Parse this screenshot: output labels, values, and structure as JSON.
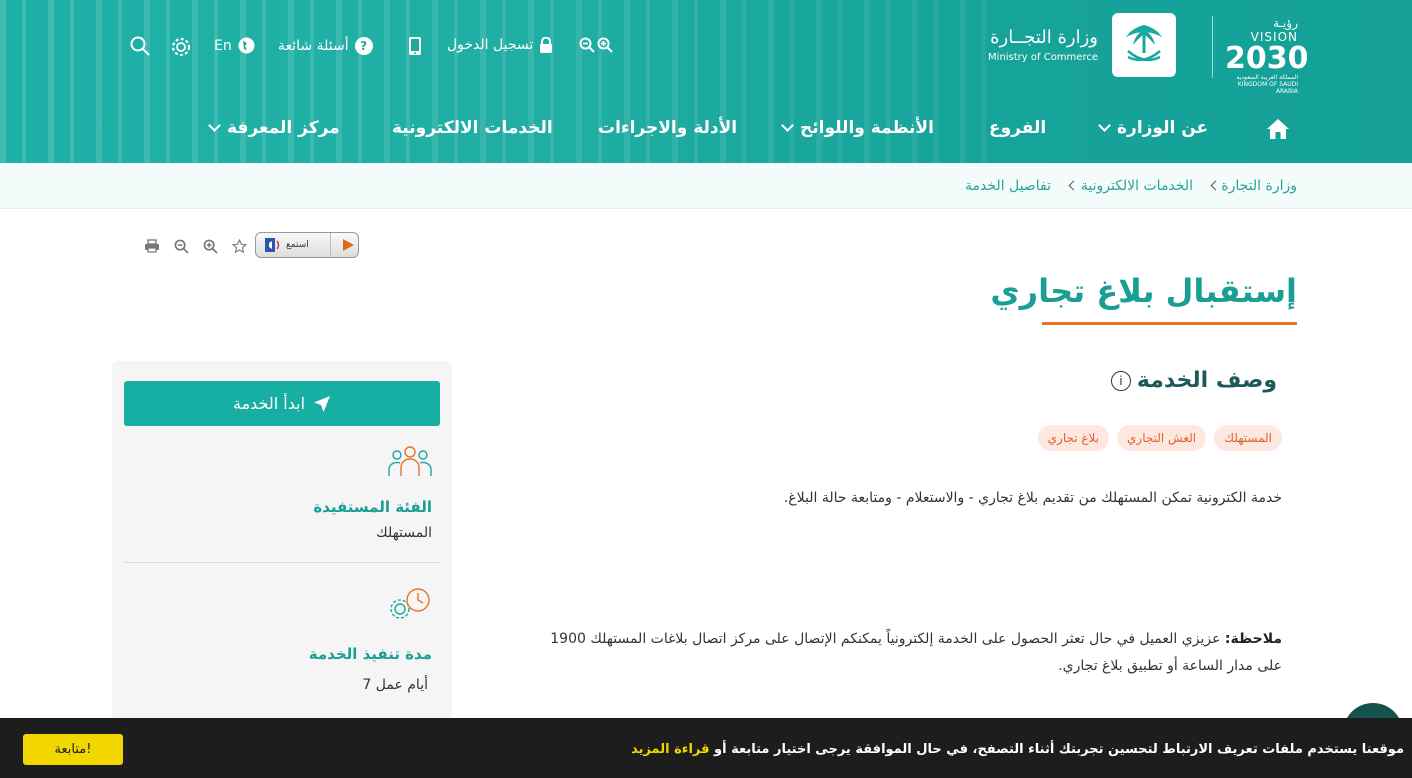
{
  "header": {
    "vision_top": "رؤيـة VISION",
    "vision_year": "2030",
    "vision_sub": "المملكة العربية السعودية KINGDOM OF SAUDI ARABIA",
    "ministry_ar": "وزارة التجــارة",
    "ministry_en": "Ministry of Commerce",
    "topbar": {
      "login": "تسجيل الدخول",
      "faq": "أسئلة شائعة",
      "lang": "En"
    },
    "nav": [
      {
        "label": "عن الوزارة"
      },
      {
        "label": "الفروع"
      },
      {
        "label": "الأنظمة واللوائح"
      },
      {
        "label": "الأدلة والاجراءات"
      },
      {
        "label": "الخدمات الالكترونية"
      },
      {
        "label": "مركز المعرفة"
      }
    ]
  },
  "breadcrumb": [
    "وزارة التجارة",
    "الخدمات الالكترونية",
    "تفاصيل الخدمة"
  ],
  "listen_label": "استمع",
  "page_title": "إستقبال بلاغ تجاري",
  "section_title": "وصف الخدمة",
  "tags": [
    "المستهلك",
    "الغش التجاري",
    "بلاغ تجاري"
  ],
  "description": "خدمة الكترونية تمكن المستهلك من تقديم بلاغ تجاري - والاستعلام - ومتابعة حالة البلاغ.",
  "note": {
    "label": "ملاحظة:",
    "text": " عزيزي العميل في حال تعثر الحصول على الخدمة إلكترونياً يمكنكم الإتصال على مركز اتصال بلاغات المستهلك 1900 على مدار الساعة أو تطبيق بلاغ تجاري."
  },
  "sidebar": {
    "start_button": "ابدأ الخدمة",
    "audience_title": "الفئة المستفيدة",
    "audience_value": "المستهلك",
    "duration_title": "مدة تنفيذ الخدمة",
    "duration_value": "7 أيام عمل"
  },
  "cookie": {
    "text": "موقعنا يستخدم ملفات تعريف الارتباط لتحسين تجربتك أثناء التصفح، في حال الموافقة يرجى اختيار متابعة أو ",
    "more": "قراءة المزيد",
    "button": "متابعة!"
  },
  "colors": {
    "teal": "#17aea4",
    "orange": "#e8742a",
    "dark": "#1d1d1d",
    "yellow": "#f2d600"
  }
}
